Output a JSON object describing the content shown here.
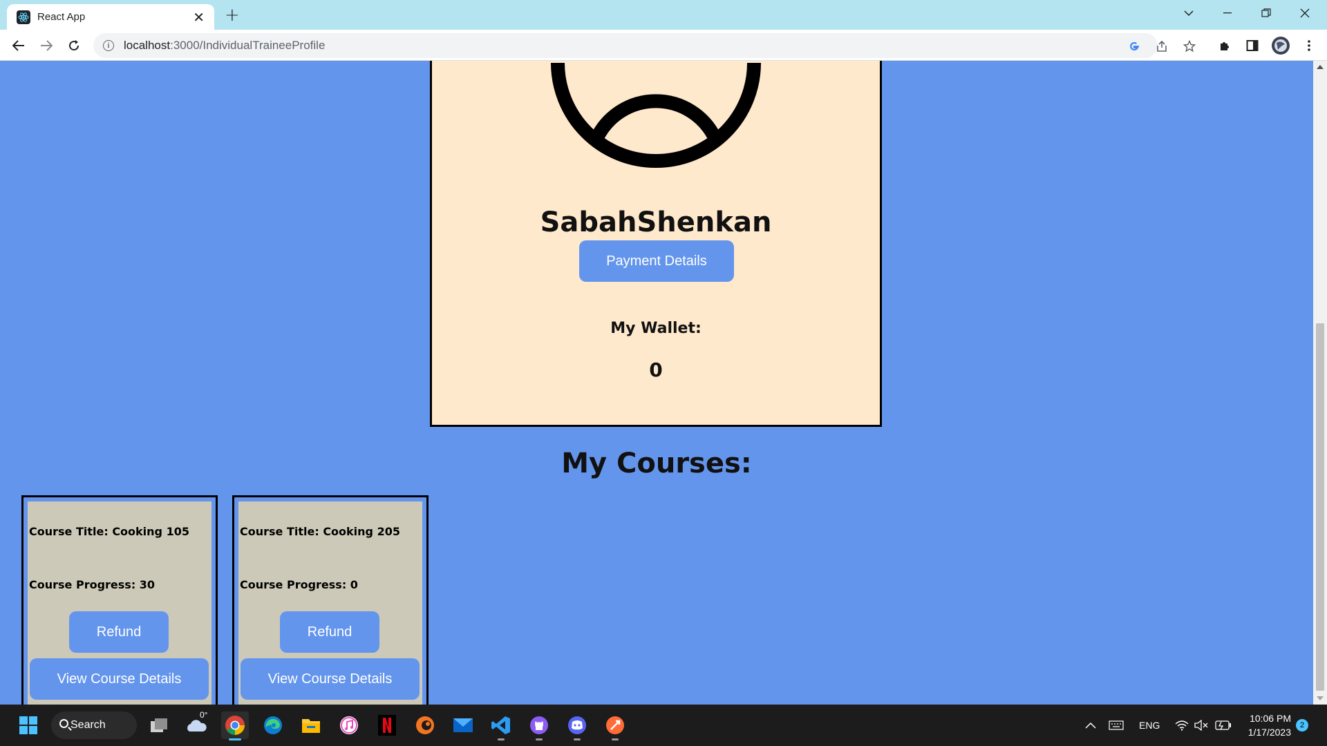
{
  "browser": {
    "tab_title": "React App",
    "url_host": "localhost",
    "url_rest": ":3000/IndividualTraineeProfile"
  },
  "profile": {
    "username": "SabahShenkan",
    "payment_button": "Payment Details",
    "wallet_label": "My Wallet:",
    "wallet_value": "0"
  },
  "courses": {
    "heading": "My Courses:",
    "items": [
      {
        "title": "Course Title: Cooking 105",
        "progress": "Course Progress: 30",
        "refund": "Refund",
        "details": "View Course Details"
      },
      {
        "title": "Course Title: Cooking 205",
        "progress": "Course Progress: 0",
        "refund": "Refund",
        "details": "View Course Details"
      }
    ]
  },
  "taskbar": {
    "search_label": "Search",
    "weather_temp": "0°",
    "language": "ENG",
    "time": "10:06 PM",
    "date": "1/17/2023",
    "notification_count": "2"
  },
  "colors": {
    "page_background": "#6495ed",
    "profile_card": "#ffe9cc",
    "course_card": "#cdc9b8",
    "button": "#6495ed"
  }
}
